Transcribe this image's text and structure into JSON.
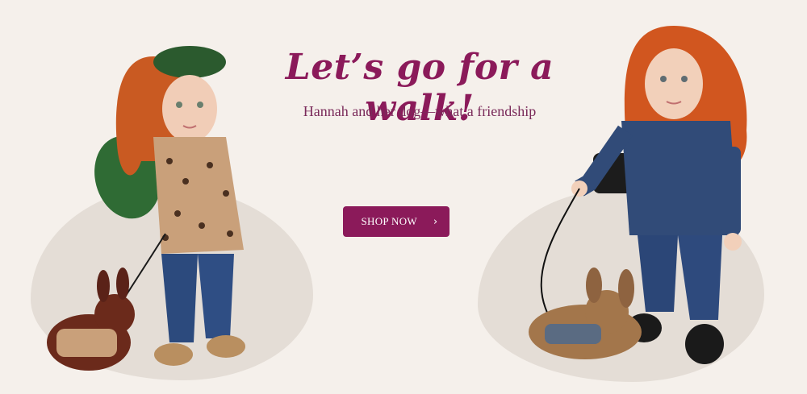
{
  "hero": {
    "headline": "Let’s go for a walk!",
    "subline": "Hannah and her dog—what a friendship",
    "cta_label": "SHOP NOW",
    "cta_icon": "chevron-right-icon",
    "accent_color": "#8b1a5a",
    "background_color": "#f5f0eb"
  },
  "images": {
    "left": "doll-with-leopard-coat-and-dog",
    "right": "doll-with-denim-jacket-and-dog"
  }
}
